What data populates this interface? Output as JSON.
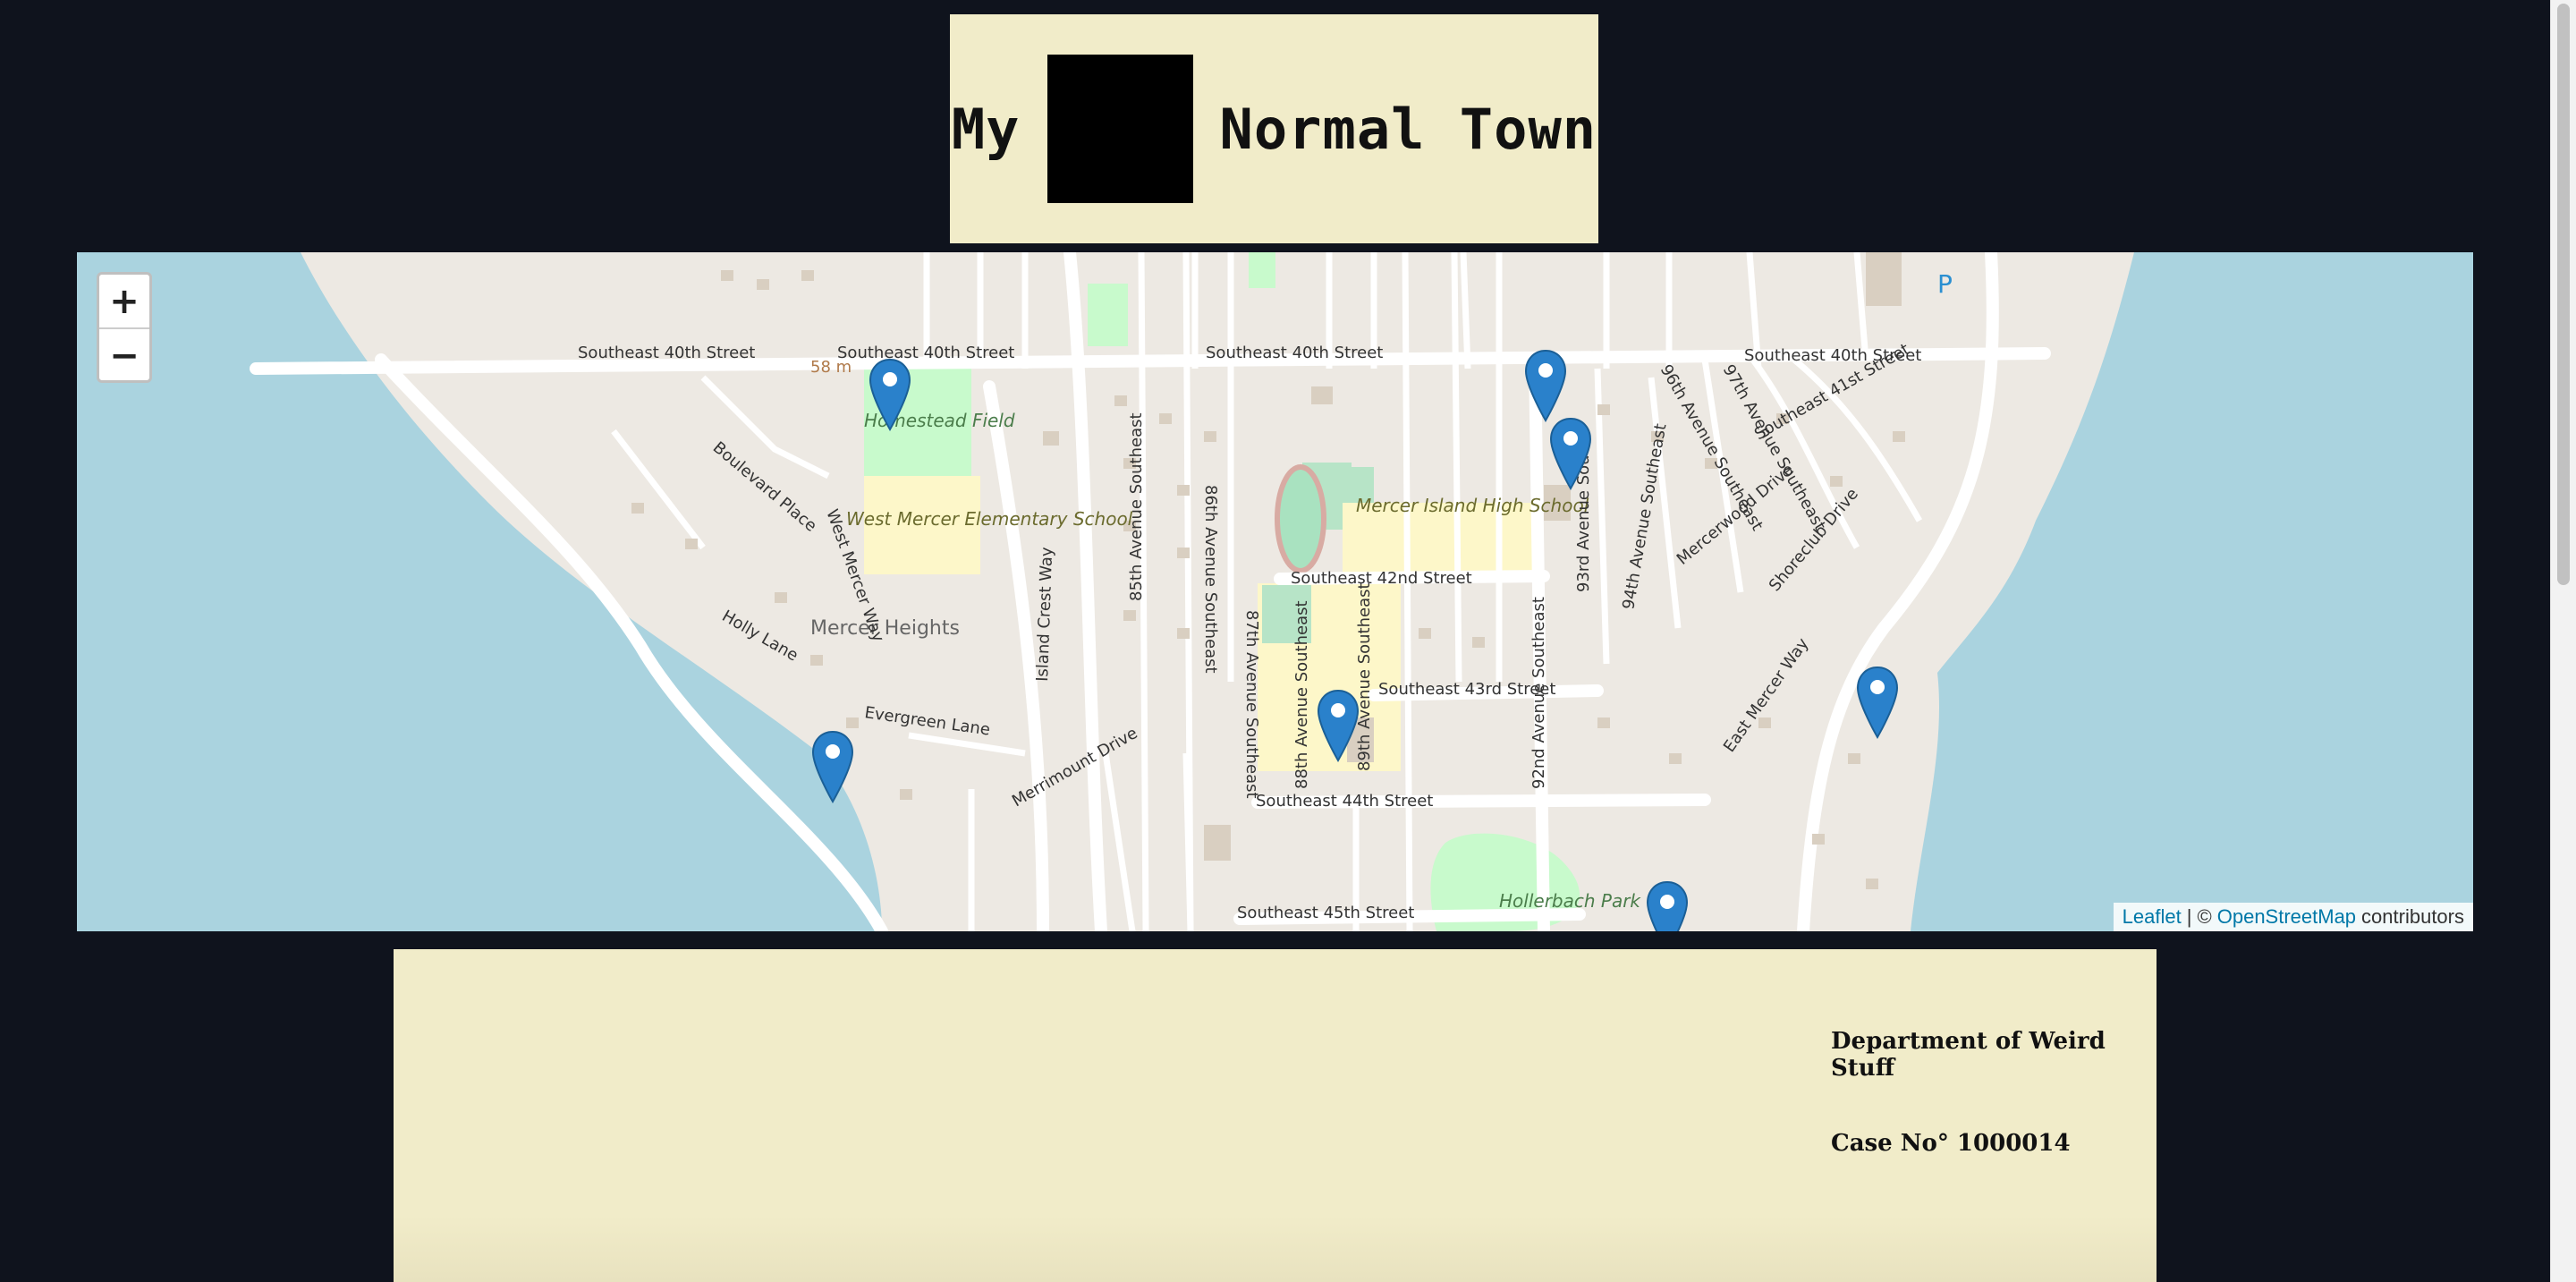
{
  "header": {
    "word_before": "My",
    "word_after": "Normal Town"
  },
  "map": {
    "zoom_in_label": "+",
    "zoom_out_label": "−",
    "place_labels": {
      "se40": "Southeast 40th Street",
      "se42": "Southeast 42nd Street",
      "se43": "Southeast 43rd Street",
      "se44": "Southeast 44th Street",
      "se45": "Southeast 45th Street",
      "homestead": "Homestead Field",
      "westmercer_school": "West Mercer Elementary School",
      "mercer_high": "Mercer Island High School",
      "mercer_heights": "Mercer Heights",
      "hollerbach": "Hollerbach Park",
      "elevation": "58 m",
      "parking": "P",
      "west_mercer_way": "West Mercer Way",
      "east_mercer_way": "East Mercer Way",
      "island_crest": "Island Crest Way",
      "evergreen": "Evergreen Lane",
      "holly": "Holly Lane",
      "boulevard": "Boulevard Place",
      "merrimount": "Merrimount Drive",
      "mercerwood": "Mercerwood Drive",
      "shoreclub": "Shoreclub Drive",
      "ave85": "85th Avenue Southeast",
      "ave86": "86th Avenue Southeast",
      "ave87": "87th Avenue Southeast",
      "ave88": "88th Avenue Southeast",
      "ave89": "89th Avenue Southeast",
      "ave92": "92nd Avenue Southeast",
      "ave93": "93rd Avenue South",
      "ave94": "94th Avenue Southeast",
      "ave96": "96th Avenue Southeast",
      "ave97": "97th Avenue Southeast",
      "se41": "Southeast 41st Street"
    },
    "marker_count": 7,
    "attribution": {
      "leaflet": "Leaflet",
      "separator": "| ©",
      "osm": "OpenStreetMap",
      "suffix": "contributors"
    }
  },
  "report": {
    "department": "Department of Weird Stuff",
    "case_number": "Case No° 1000014"
  }
}
